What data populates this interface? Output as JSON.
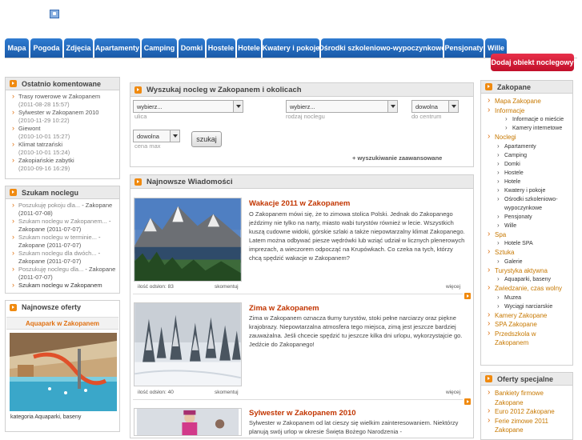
{
  "nav": {
    "tabs": [
      "Mapa",
      "Pogoda",
      "Zdjęcia",
      "Apartamenty",
      "Camping",
      "Domki",
      "Hostele",
      "Hotele",
      "Kwatery i pokoje",
      "Ośrodki szkoleniowo-wypoczynkowe",
      "Pensjonaty",
      "Wille"
    ],
    "add_button": "Dodaj obiekt noclegowy"
  },
  "left": {
    "comments": {
      "title": "Ostatnio komentowane",
      "items": [
        {
          "name": "Trasy rowerowe w Zakopanem",
          "date": "(2011-08-28 15:57)"
        },
        {
          "name": "Sylwester w Zakopanem 2010",
          "date": "(2010-11-29 10:22)"
        },
        {
          "name": "Giewont",
          "date": "(2010-10-01 15:27)"
        },
        {
          "name": "Klimat tatrzański",
          "date": "(2010-10-01 15:24)"
        },
        {
          "name": "Zakopiańskie zabytki",
          "date": "(2010-09-16 16:29)"
        }
      ]
    },
    "looking": {
      "title": "Szukam noclegu",
      "items": [
        {
          "a": "Poszukuję pokoju dla...",
          "b": " - Zakopane (2011-07-08)"
        },
        {
          "a": "Szukam noclegu w Zakopanem...",
          "b": " - Zakopane (2011-07-07)"
        },
        {
          "a": "Szukam noclegu w terminie...",
          "b": " - Zakopane (2011-07-07)"
        },
        {
          "a": "Szukam noclegu dla dwóch...",
          "b": " - Zakopane (2011-07-07)"
        },
        {
          "a": "Poszukuję noclegu dla...",
          "b": " - Zakopane (2011-07-07)"
        }
      ],
      "last": "Szukam noclegu w Zakopanem"
    },
    "offers": {
      "title": "Najnowsze oferty",
      "offer_title": "Aquapark w Zakopanem",
      "category_label": "kategoria",
      "category": "Aquaparki, baseny"
    }
  },
  "search": {
    "title": "Wyszukaj nocleg w Zakopanem i okolicach",
    "street_value": "wybierz...",
    "street_label": "ulica",
    "type_value": "wybierz...",
    "type_label": "rodzaj noclegu",
    "center_value": "dowolna",
    "center_label": "do centrum",
    "price_value": "dowolna",
    "price_label": "cena max",
    "button": "szukaj",
    "advanced": "+ wyszukiwanie zaawansowane"
  },
  "news": {
    "title": "Najnowsze Wiadomości",
    "items": [
      {
        "title": "Wakacje 2011 w Zakopanem",
        "text": "O Zakopanem mówi się, że to zimowa stolica Polski. Jednak do Zakopanego jeździmy nie tylko na narty, miasto wabi turystów również w lecie. Wszystkich kuszą cudowne widoki, górskie szlaki a także niepowtarzalny klimat Zakopanego. Latem można odbywać piesze wędrówki lub wziąć udział w licznych plenerowych imprezach, a wieczorem odpocząć na Krupówkach. Co czeka na tych, którzy chcą spędzić wakacje w Zakopanem?",
        "photos": "ilość odsłon: 83",
        "comment": "skomentuj",
        "more": "więcej"
      },
      {
        "title": "Zima w Zakopanem",
        "text": "Zima w Zakopanem oznacza tłumy turystów, stoki pełne narciarzy oraz piękne krajobrazy. Niepowtarzalna atmosfera tego miejsca, zimą jest jeszcze bardziej zauważalna. Jeśli chcecie spędzić tu jeszcze kilka dni urlopu, wykorzystajcie go. Jedźcie do Zakopanego!",
        "photos": "ilość odsłon: 40",
        "comment": "skomentuj",
        "more": "więcej"
      },
      {
        "title": "Sylwester w Zakopanem 2010",
        "text": "Sylwester w Zakopanem od lat cieszy się wielkim zainteresowaniem. Niektórzy planują swój urlop w okresie Święta Bożego Narodzenia -"
      }
    ]
  },
  "right": {
    "zakopane": {
      "title": "Zakopane",
      "items": [
        {
          "t": "Mapa Zakopane",
          "lvl": 0
        },
        {
          "t": "Informacje",
          "lvl": 0
        },
        {
          "t": "Informacje o mieście",
          "lvl": 2
        },
        {
          "t": "Kamery internetowe",
          "lvl": 2
        },
        {
          "t": "Noclegi",
          "lvl": 0
        },
        {
          "t": "Apartamenty",
          "lvl": 1
        },
        {
          "t": "Camping",
          "lvl": 1
        },
        {
          "t": "Domki",
          "lvl": 1
        },
        {
          "t": "Hostele",
          "lvl": 1
        },
        {
          "t": "Hotele",
          "lvl": 1
        },
        {
          "t": "Kwatery i pokoje",
          "lvl": 1
        },
        {
          "t": "Ośrodki szkoleniowo-",
          "lvl": 1
        },
        {
          "t": "wypoczynkowe",
          "lvl": 3
        },
        {
          "t": "Pensjonaty",
          "lvl": 1
        },
        {
          "t": "Wille",
          "lvl": 1
        },
        {
          "t": "Spa",
          "lvl": 0
        },
        {
          "t": "Hotele SPA",
          "lvl": 1
        },
        {
          "t": "Sztuka",
          "lvl": 0
        },
        {
          "t": "Galerie",
          "lvl": 1
        },
        {
          "t": "Turystyka aktywna",
          "lvl": 0
        },
        {
          "t": "Aquaparki, baseny",
          "lvl": 1
        },
        {
          "t": "Zwiedzanie, czas wolny",
          "lvl": 0
        },
        {
          "t": "Muzea",
          "lvl": 1
        },
        {
          "t": "Wyciągi narciarskie",
          "lvl": 1
        },
        {
          "t": "Kamery Zakopane",
          "lvl": 0
        },
        {
          "t": "SPA Zakopane",
          "lvl": 0
        },
        {
          "t": "Przedszkola w",
          "lvl": 0
        },
        {
          "t": "Zakopanem",
          "lvl": 4
        }
      ]
    },
    "special": {
      "title": "Oferty specjalne",
      "items": [
        {
          "t": "Bankiety firmowe",
          "lvl": 0
        },
        {
          "t": "Zakopane",
          "lvl": 4
        },
        {
          "t": "Euro 2012 Zakopane",
          "lvl": 0
        },
        {
          "t": "Ferie zimowe 2011",
          "lvl": 0
        },
        {
          "t": "Zakopane",
          "lvl": 4
        }
      ]
    }
  },
  "colors": {
    "nav_blue": "#1f64b8",
    "accent_orange": "#f08a10",
    "title_red": "#c23500",
    "add_button_red": "#d81a38"
  }
}
